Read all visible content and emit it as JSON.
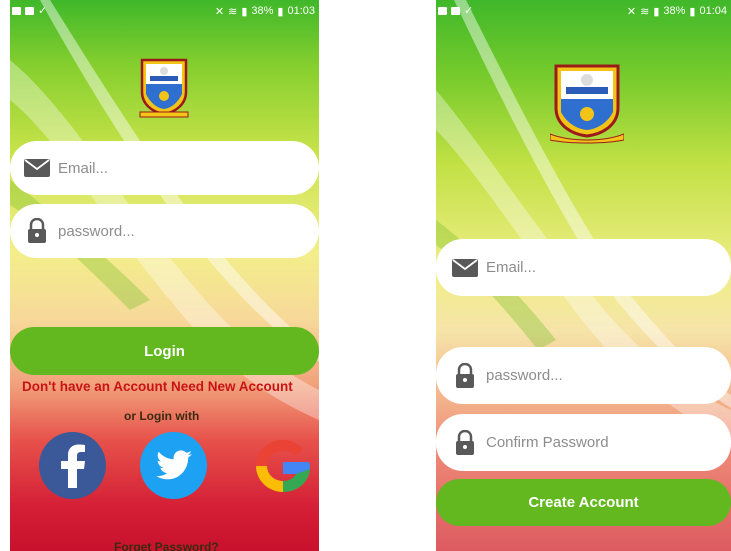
{
  "colors": {
    "button_green": "#64b81f",
    "link_red": "#c81414",
    "facebook_blue": "#3b5998",
    "twitter_blue": "#1da1f2"
  },
  "status_bar": {
    "left": {
      "icons": [
        "message-icon",
        "image-icon",
        "download-done-icon"
      ],
      "battery": "38%",
      "time": "01:03"
    },
    "right": {
      "icons": [
        "image-icon",
        "message-icon",
        "download-done-icon"
      ],
      "battery": "38%",
      "time": "01:04"
    }
  },
  "login_screen": {
    "email_placeholder": "Email...",
    "password_placeholder": "password...",
    "login_button": "Login",
    "signup_prompt": "Don't have an Account Need New Account",
    "or_login_with": "or Login with",
    "social": [
      "facebook",
      "twitter",
      "google"
    ],
    "forgot_password": "Forget Password?"
  },
  "signup_screen": {
    "email_placeholder": "Email...",
    "password_placeholder": "password...",
    "confirm_password_placeholder": "Confirm Password",
    "create_button": "Create Account"
  }
}
